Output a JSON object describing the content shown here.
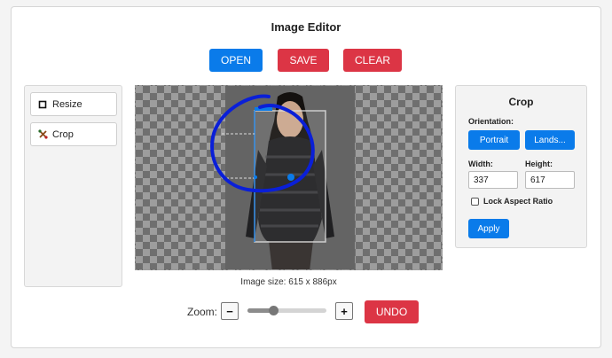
{
  "app": {
    "title": "Image Editor"
  },
  "toolbar": {
    "open_label": "OPEN",
    "save_label": "SAVE",
    "clear_label": "CLEAR"
  },
  "sidebar": {
    "items": [
      {
        "label": "Resize",
        "icon": "square-icon"
      },
      {
        "label": "Crop",
        "icon": "crop-icon"
      }
    ]
  },
  "canvas": {
    "image_size_text": "Image size: 615 x 886px"
  },
  "crop_panel": {
    "title": "Crop",
    "orientation_label": "Orientation:",
    "portrait_label": "Portrait",
    "landscape_label": "Lands...",
    "width_label": "Width:",
    "height_label": "Height:",
    "width_value": "337",
    "height_value": "617",
    "lock_label": "Lock Aspect Ratio",
    "lock_checked": false,
    "apply_label": "Apply"
  },
  "zoom": {
    "label": "Zoom:",
    "minus": "−",
    "plus": "+",
    "level_fraction": 0.33,
    "undo_label": "UNDO"
  },
  "colors": {
    "primary": "#0a7bea",
    "danger": "#dc3545",
    "annotation": "#0a1fd8"
  }
}
